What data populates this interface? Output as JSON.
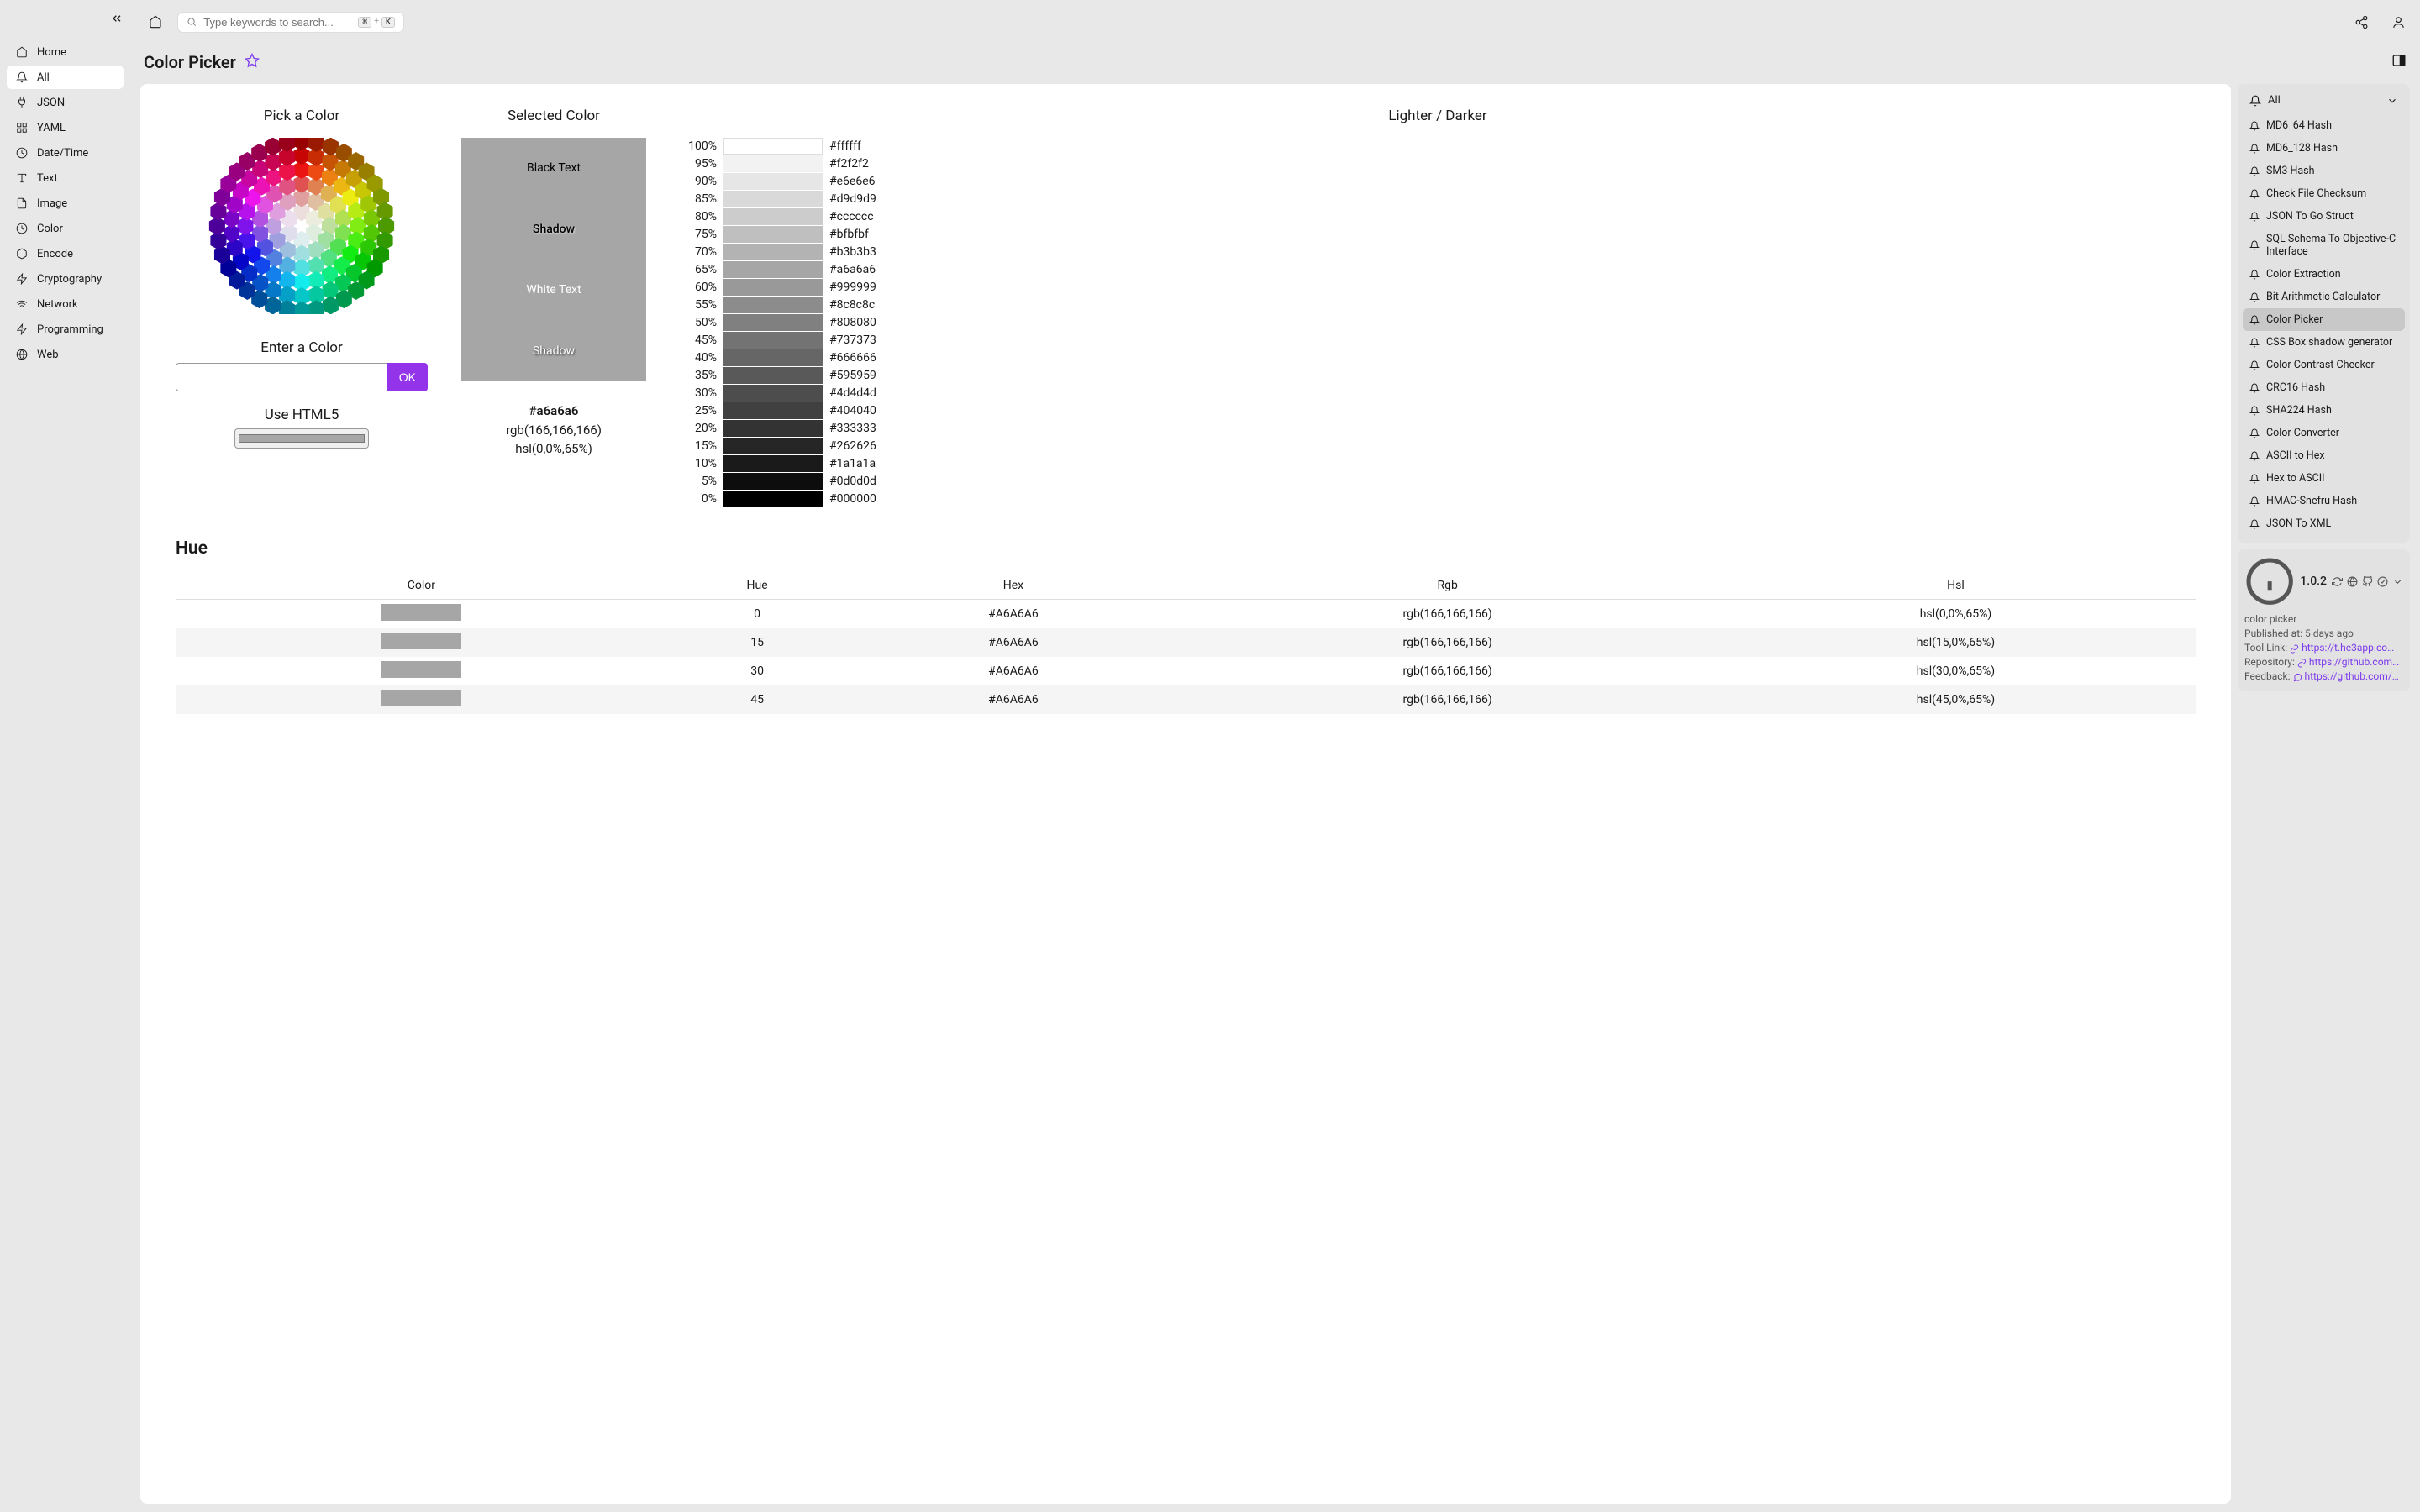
{
  "sidebar": {
    "items": [
      {
        "label": "Home",
        "icon": "home"
      },
      {
        "label": "All",
        "icon": "bell",
        "active": true
      },
      {
        "label": "JSON",
        "icon": "plug"
      },
      {
        "label": "YAML",
        "icon": "grid"
      },
      {
        "label": "Date/Time",
        "icon": "clock"
      },
      {
        "label": "Text",
        "icon": "text"
      },
      {
        "label": "Image",
        "icon": "file"
      },
      {
        "label": "Color",
        "icon": "clock"
      },
      {
        "label": "Encode",
        "icon": "box"
      },
      {
        "label": "Cryptography",
        "icon": "zap"
      },
      {
        "label": "Network",
        "icon": "wifi"
      },
      {
        "label": "Programming",
        "icon": "zap"
      },
      {
        "label": "Web",
        "icon": "globe"
      }
    ]
  },
  "search": {
    "placeholder": "Type keywords to search...",
    "kbd1": "⌘",
    "plus": "+",
    "kbd2": "K"
  },
  "page": {
    "title": "Color Picker"
  },
  "picker": {
    "pick_title": "Pick a Color",
    "enter_title": "Enter a Color",
    "ok_label": "OK",
    "html5_title": "Use HTML5",
    "selected_title": "Selected Color",
    "swatches": {
      "black": "Black Text",
      "shadow1": "Shadow",
      "white": "White Text",
      "shadow2": "Shadow"
    },
    "selected_hex": "#a6a6a6",
    "selected_rgb": "rgb(166,166,166)",
    "selected_hsl": "hsl(0,0%,65%)",
    "shade_title": "Lighter / Darker",
    "shades": [
      {
        "pct": "100%",
        "hex": "#ffffff",
        "color": "#ffffff"
      },
      {
        "pct": "95%",
        "hex": "#f2f2f2",
        "color": "#f2f2f2"
      },
      {
        "pct": "90%",
        "hex": "#e6e6e6",
        "color": "#e6e6e6"
      },
      {
        "pct": "85%",
        "hex": "#d9d9d9",
        "color": "#d9d9d9"
      },
      {
        "pct": "80%",
        "hex": "#cccccc",
        "color": "#cccccc"
      },
      {
        "pct": "75%",
        "hex": "#bfbfbf",
        "color": "#bfbfbf"
      },
      {
        "pct": "70%",
        "hex": "#b3b3b3",
        "color": "#b3b3b3"
      },
      {
        "pct": "65%",
        "hex": "#a6a6a6",
        "color": "#a6a6a6"
      },
      {
        "pct": "60%",
        "hex": "#999999",
        "color": "#999999"
      },
      {
        "pct": "55%",
        "hex": "#8c8c8c",
        "color": "#8c8c8c"
      },
      {
        "pct": "50%",
        "hex": "#808080",
        "color": "#808080"
      },
      {
        "pct": "45%",
        "hex": "#737373",
        "color": "#737373"
      },
      {
        "pct": "40%",
        "hex": "#666666",
        "color": "#666666"
      },
      {
        "pct": "35%",
        "hex": "#595959",
        "color": "#595959"
      },
      {
        "pct": "30%",
        "hex": "#4d4d4d",
        "color": "#4d4d4d"
      },
      {
        "pct": "25%",
        "hex": "#404040",
        "color": "#404040"
      },
      {
        "pct": "20%",
        "hex": "#333333",
        "color": "#333333"
      },
      {
        "pct": "15%",
        "hex": "#262626",
        "color": "#262626"
      },
      {
        "pct": "10%",
        "hex": "#1a1a1a",
        "color": "#1a1a1a"
      },
      {
        "pct": "5%",
        "hex": "#0d0d0d",
        "color": "#0d0d0d"
      },
      {
        "pct": "0%",
        "hex": "#000000",
        "color": "#000000"
      }
    ]
  },
  "hue": {
    "title": "Hue",
    "headers": [
      "Color",
      "Hue",
      "Hex",
      "Rgb",
      "Hsl"
    ],
    "rows": [
      {
        "hue": "0",
        "hex": "#A6A6A6",
        "rgb": "rgb(166,166,166)",
        "hsl": "hsl(0,0%,65%)",
        "color": "#a6a6a6"
      },
      {
        "hue": "15",
        "hex": "#A6A6A6",
        "rgb": "rgb(166,166,166)",
        "hsl": "hsl(15,0%,65%)",
        "color": "#a6a6a6"
      },
      {
        "hue": "30",
        "hex": "#A6A6A6",
        "rgb": "rgb(166,166,166)",
        "hsl": "hsl(30,0%,65%)",
        "color": "#a6a6a6"
      },
      {
        "hue": "45",
        "hex": "#A6A6A6",
        "rgb": "rgb(166,166,166)",
        "hsl": "hsl(45,0%,65%)",
        "color": "#a6a6a6"
      }
    ]
  },
  "right_panel": {
    "header": "All",
    "items": [
      {
        "label": "MD6_64 Hash"
      },
      {
        "label": "MD6_128 Hash"
      },
      {
        "label": "SM3 Hash"
      },
      {
        "label": "Check File Checksum"
      },
      {
        "label": "JSON To Go Struct"
      },
      {
        "label": "SQL Schema To Objective-C Interface"
      },
      {
        "label": "Color Extraction"
      },
      {
        "label": "Bit Arithmetic Calculator"
      },
      {
        "label": "Color Picker",
        "active": true
      },
      {
        "label": "CSS Box shadow generator"
      },
      {
        "label": "Color Contrast Checker"
      },
      {
        "label": "CRC16 Hash"
      },
      {
        "label": "SHA224 Hash"
      },
      {
        "label": "Color Converter"
      },
      {
        "label": "ASCII to Hex"
      },
      {
        "label": "Hex to ASCII"
      },
      {
        "label": "HMAC-Snefru Hash"
      },
      {
        "label": "JSON To XML"
      }
    ],
    "meta": {
      "version": "1.0.2",
      "name": "color picker",
      "published_label": "Published at:",
      "published_val": "5 days ago",
      "tool_link_label": "Tool Link:",
      "tool_link_val": "https://t.he3app.co…",
      "repo_label": "Repository:",
      "repo_val": "https://github.com…",
      "feedback_label": "Feedback:",
      "feedback_val": "https://github.com/…"
    }
  }
}
